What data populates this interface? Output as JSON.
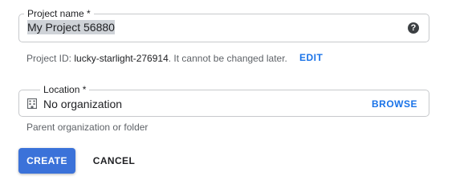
{
  "project_name": {
    "label": "Project name *",
    "value": "My Project 56880",
    "help_icon": "help-icon"
  },
  "project_id_hint": {
    "prefix": "Project ID: ",
    "id": "lucky-starlight-276914",
    "suffix": ". It cannot be changed later.",
    "edit_label": "EDIT"
  },
  "location": {
    "label": "Location *",
    "value": "No organization",
    "icon": "organization-icon",
    "browse_label": "BROWSE",
    "hint": "Parent organization or folder"
  },
  "actions": {
    "create_label": "CREATE",
    "cancel_label": "CANCEL"
  },
  "colors": {
    "accent": "#1a73e8",
    "primary_button": "#3b72d9"
  }
}
